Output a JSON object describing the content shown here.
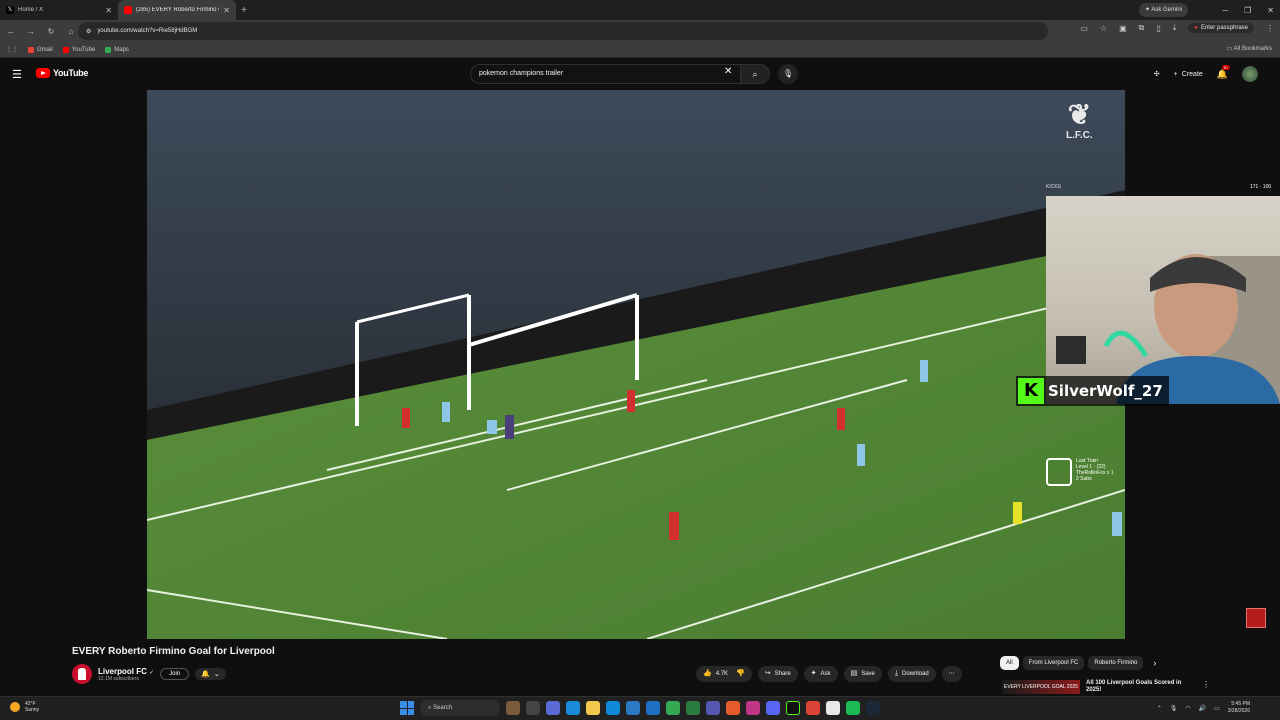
{
  "browser": {
    "tabs": [
      {
        "title": "Home / X",
        "icon": "x-icon"
      },
      {
        "title": "(285) EVERY Roberto Firmino G...",
        "icon": "youtube-icon"
      }
    ],
    "new_tab": "+",
    "ask_gemini": "Ask Gemini",
    "url": "youtube.com/watch?v=Rie58jHdBGM",
    "passphrase": "Enter passphrase",
    "bookmarks": [
      {
        "label": "Gmail",
        "color": "#ea4335"
      },
      {
        "label": "YouTube",
        "color": "#ff0000"
      },
      {
        "label": "Maps",
        "color": "#34a853"
      }
    ],
    "all_bookmarks": "All Bookmarks"
  },
  "youtube": {
    "logo": "YouTube",
    "search_query": "pokemon champions trailer",
    "create": "Create",
    "notif_badge": "9+"
  },
  "player": {
    "overlay_brand": "L.F.C.",
    "kicks_label": "KICKS",
    "counter": "171 · 100",
    "streamer": "SilverWolf_27",
    "train": {
      "title": "Lust Train",
      "level": "Level 1 · (22)",
      "user": "TheRollinFox x 1",
      "subs": "2 Subs"
    }
  },
  "video": {
    "title": "EVERY Roberto Firmino Goal for Liverpool",
    "channel": "Liverpool FC",
    "subscribers": "12.1M subscribers",
    "join": "Join",
    "likes": "4.7K",
    "share": "Share",
    "ask": "Ask",
    "save": "Save",
    "download": "Download"
  },
  "sidebar_chips": [
    "All",
    "From Liverpool FC",
    "Roberto Firmino"
  ],
  "recommendation": {
    "thumb_text": "EVERY LIVERPOOL GOAL 2025",
    "title": "All 100 Liverpool Goals Scored in 2025!"
  },
  "taskbar": {
    "temp": "42°F",
    "weather": "Sunny",
    "search": "Search",
    "time": "5:45 PM",
    "date": "3/28/2026"
  }
}
